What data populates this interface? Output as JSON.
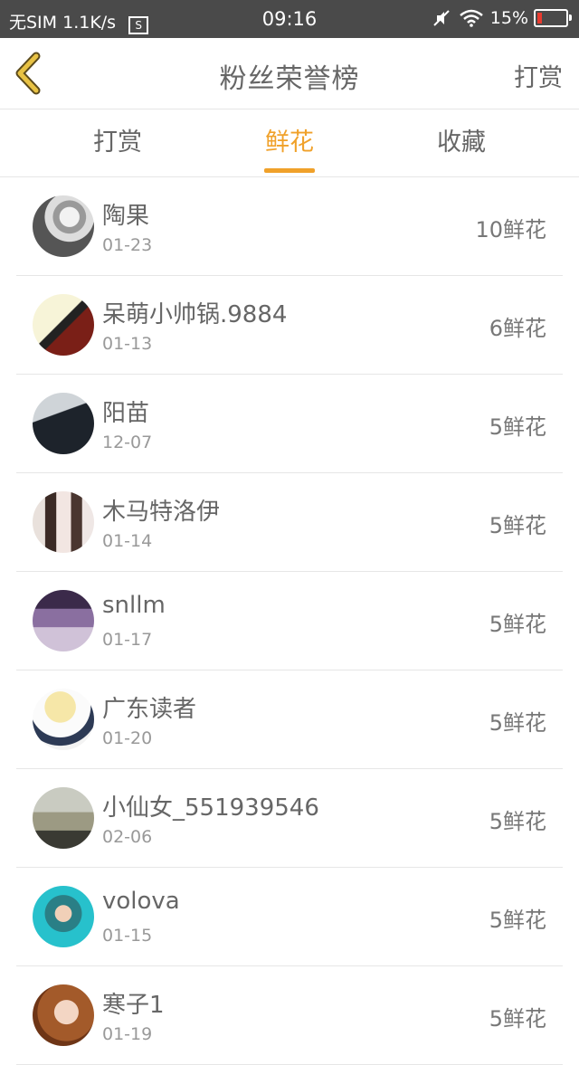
{
  "status_bar": {
    "carrier": "无SIM",
    "speed": "1.1K/s",
    "sim_icon": "S",
    "time": "09:16",
    "battery": "15%",
    "battery_level": 0.15
  },
  "header": {
    "title": "粉丝荣誉榜",
    "right_label": "打赏",
    "back_icon": "chevron-left"
  },
  "tabs": [
    {
      "label": "打赏",
      "active": false
    },
    {
      "label": "鲜花",
      "active": true
    },
    {
      "label": "收藏",
      "active": false
    }
  ],
  "accent_color": "#f0a12a",
  "fans": [
    {
      "name": "陶果",
      "date": "01-23",
      "count": "10鲜花"
    },
    {
      "name": "呆萌小帅锅.9884",
      "date": "01-13",
      "count": "6鲜花"
    },
    {
      "name": "阳苗",
      "date": "12-07",
      "count": "5鲜花"
    },
    {
      "name": "木马特洛伊",
      "date": "01-14",
      "count": "5鲜花"
    },
    {
      "name": "snllm",
      "date": "01-17",
      "count": "5鲜花"
    },
    {
      "name": "广东读者",
      "date": "01-20",
      "count": "5鲜花"
    },
    {
      "name": "小仙女_551939546",
      "date": "02-06",
      "count": "5鲜花"
    },
    {
      "name": "volova",
      "date": "01-15",
      "count": "5鲜花"
    },
    {
      "name": "寒子1",
      "date": "01-19",
      "count": "5鲜花"
    }
  ]
}
